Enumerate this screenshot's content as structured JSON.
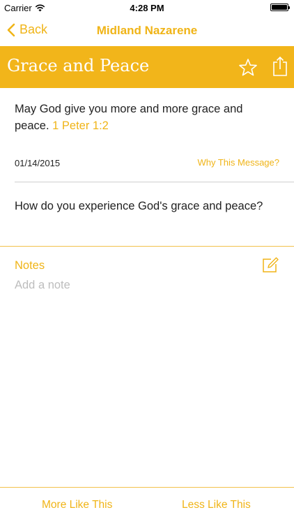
{
  "status_bar": {
    "carrier": "Carrier",
    "time": "4:28 PM",
    "wifi_icon": "wifi-icon",
    "battery_icon": "battery-icon"
  },
  "nav": {
    "back_label": "Back",
    "title": "Midland Nazarene",
    "back_icon": "chevron-left-icon"
  },
  "banner": {
    "title": "Grace and Peace",
    "background_color": "#f2b51a",
    "star_icon": "star-outline-icon",
    "share_icon": "share-icon"
  },
  "message": {
    "text": "May God give you more and more grace and peace.",
    "reference": "1 Peter 1:2",
    "date": "01/14/2015",
    "why_link": "Why This Message?"
  },
  "question": {
    "text": "How do you experience God's grace and peace?"
  },
  "notes": {
    "label": "Notes",
    "placeholder": "Add a note",
    "value": "",
    "edit_icon": "edit-icon"
  },
  "footer": {
    "more_label": "More Like This",
    "less_label": "Less Like This"
  },
  "colors": {
    "accent": "#f0b417",
    "banner": "#f2b51a"
  }
}
